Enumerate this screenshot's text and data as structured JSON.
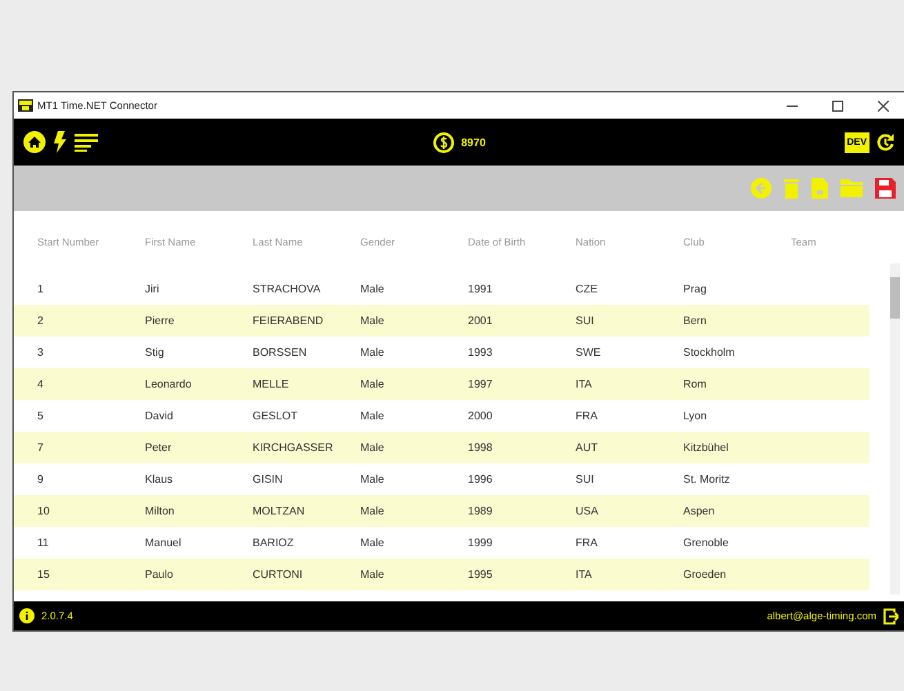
{
  "window": {
    "title": "MT1 Time.NET Connector"
  },
  "top_bar": {
    "credits": "8970",
    "badge": "DEV"
  },
  "table": {
    "columns": [
      "Start Number",
      "First Name",
      "Last Name",
      "Gender",
      "Date of Birth",
      "Nation",
      "Club",
      "Team"
    ],
    "rows": [
      [
        "1",
        "Jiri",
        "STRACHOVA",
        "Male",
        "1991",
        "CZE",
        "Prag"
      ],
      [
        "2",
        "Pierre",
        "FEIERABEND",
        "Male",
        "2001",
        "SUI",
        "Bern"
      ],
      [
        "3",
        "Stig",
        "BORSSEN",
        "Male",
        "1993",
        "SWE",
        "Stockholm"
      ],
      [
        "4",
        "Leonardo",
        "MELLE",
        "Male",
        "1997",
        "ITA",
        "Rom"
      ],
      [
        "5",
        "David",
        "GESLOT",
        "Male",
        "2000",
        "FRA",
        "Lyon"
      ],
      [
        "7",
        "Peter",
        "KIRCHGASSER",
        "Male",
        "1998",
        "AUT",
        "Kitzbühel"
      ],
      [
        "9",
        "Klaus",
        "GISIN",
        "Male",
        "1996",
        "SUI",
        "St. Moritz"
      ],
      [
        "10",
        "Milton",
        "MOLTZAN",
        "Male",
        "1989",
        "USA",
        "Aspen"
      ],
      [
        "11",
        "Manuel",
        "BARIOZ",
        "Male",
        "1999",
        "FRA",
        "Grenoble"
      ],
      [
        "15",
        "Paulo",
        "CURTONI",
        "Male",
        "1995",
        "ITA",
        "Groeden"
      ]
    ]
  },
  "status_bar": {
    "version": "2.0.7.4",
    "user": "albert@alge-timing.com"
  }
}
